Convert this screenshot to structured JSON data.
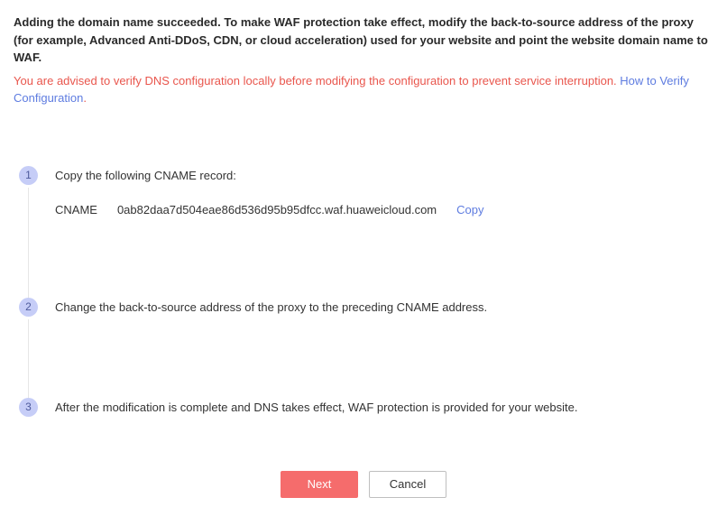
{
  "heading": "Adding the domain name succeeded. To make WAF protection take effect, modify the back-to-source address of the proxy (for example, Advanced Anti-DDoS, CDN, or cloud acceleration) used for your website and point the website domain name to WAF.",
  "warning": {
    "text": "You are advised to verify DNS configuration locally before modifying the configuration to prevent service interruption. ",
    "link_label": "How to Verify Configuration",
    "suffix": "."
  },
  "steps": {
    "s1": {
      "num": "1",
      "title": "Copy the following CNAME record:",
      "cname_label": "CNAME",
      "cname_value": "0ab82daa7d504eae86d536d95b95dfcc.waf.huaweicloud.com",
      "copy_label": "Copy"
    },
    "s2": {
      "num": "2",
      "title": "Change the back-to-source address of the proxy to the preceding CNAME address."
    },
    "s3": {
      "num": "3",
      "title": "After the modification is complete and DNS takes effect, WAF protection is provided for your website."
    }
  },
  "buttons": {
    "next": "Next",
    "cancel": "Cancel"
  }
}
